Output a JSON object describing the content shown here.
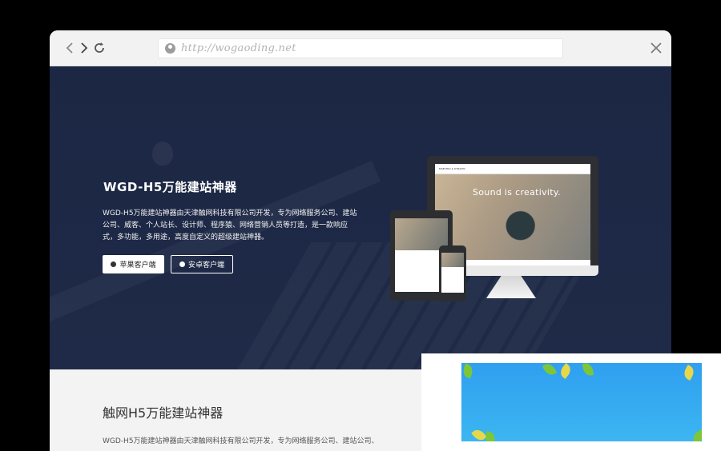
{
  "browser": {
    "url": "http://wogaoding.net",
    "icons": [
      "back-icon",
      "forward-icon",
      "refresh-icon",
      "globe-icon",
      "close-icon"
    ]
  },
  "hero": {
    "title": "WGD-H5万能建站神器",
    "description": "WGD-H5万能建站神器由天津触网科技有限公司开发，专为网络服务公司、建站公司、威客、个人站长、设计师、程序猿、网络营销人员等打造，是一款响应式，多功能，多用途，高度自定义的超级建站神器。",
    "buttons": {
      "ios_label": "苹果客户端",
      "android_label": "安卓客户端"
    },
    "mockup": {
      "monitor_brand": "MAESTRO & DYNAMIC",
      "monitor_slogan": "Sound is creativity."
    }
  },
  "section": {
    "title": "触网H5万能建站神器",
    "description": "WGD-H5万能建站神器由天津触网科技有限公司开发，专为网络服务公司、建站公司、"
  },
  "colors": {
    "hero_bg": "#1e2a47",
    "popup_sky": "#35aaf0",
    "leaf_green": "#7cc63a"
  }
}
